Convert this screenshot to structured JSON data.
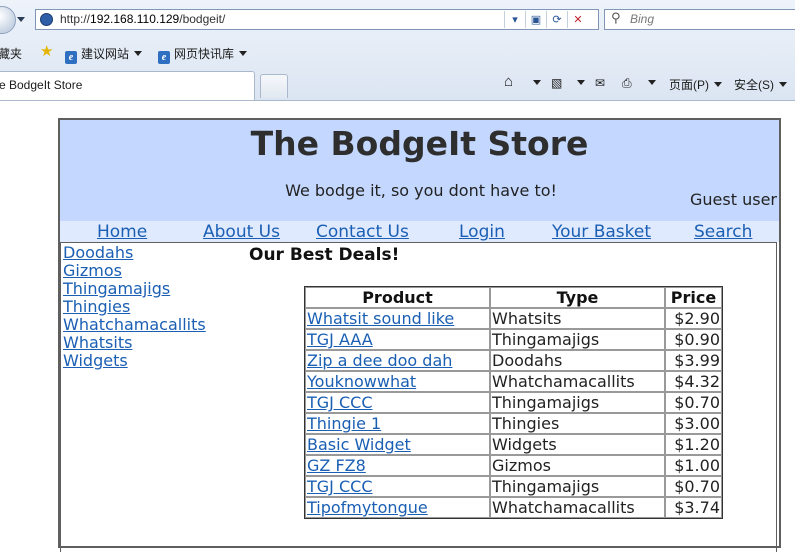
{
  "browser": {
    "url": "http://192.168.110.129/bodgeit/",
    "url_prefix": "http://",
    "url_host": "192.168.110.129",
    "url_path": "/bodgeit/",
    "search_placeholder": "Bing",
    "favorites_label": "藏夹",
    "fav_items": [
      "建议网站",
      "网页快讯库"
    ],
    "tab_title": "e BodgeIt Store",
    "commands": {
      "page": "页面(P)",
      "safety": "安全(S)"
    }
  },
  "store": {
    "title": "The BodgeIt Store",
    "tagline": "We bodge it, so you dont have to!",
    "user": "Guest user",
    "menu": [
      "Home",
      "About Us",
      "Contact Us",
      "Login",
      "Your Basket",
      "Search"
    ],
    "categories": [
      "Doodahs",
      "Gizmos",
      "Thingamajigs",
      "Thingies",
      "Whatchamacallits",
      "Whatsits",
      "Widgets"
    ],
    "deals_title": "Our Best Deals!",
    "table": {
      "headers": [
        "Product",
        "Type",
        "Price"
      ],
      "rows": [
        [
          "Whatsit sound like",
          "Whatsits",
          "$2.90"
        ],
        [
          "TGJ AAA",
          "Thingamajigs",
          "$0.90"
        ],
        [
          "Zip a dee doo dah",
          "Doodahs",
          "$3.99"
        ],
        [
          "Youknowwhat",
          "Whatchamacallits",
          "$4.32"
        ],
        [
          "TGJ CCC",
          "Thingamajigs",
          "$0.70"
        ],
        [
          "Thingie 1",
          "Thingies",
          "$3.00"
        ],
        [
          "Basic Widget",
          "Widgets",
          "$1.20"
        ],
        [
          "GZ FZ8",
          "Gizmos",
          "$1.00"
        ],
        [
          "TGJ CCC",
          "Thingamajigs",
          "$0.70"
        ],
        [
          "Tipofmytongue",
          "Whatchamacallits",
          "$3.74"
        ]
      ]
    }
  }
}
